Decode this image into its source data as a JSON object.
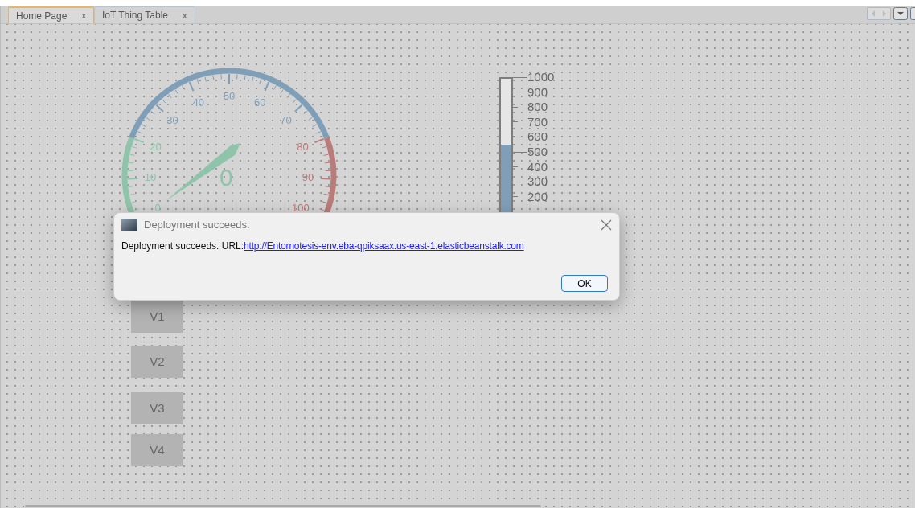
{
  "tabs": [
    {
      "label": "Home Page",
      "close": "x",
      "selected": true
    },
    {
      "label": "IoT Thing Table",
      "close": "x",
      "selected": false
    }
  ],
  "gauge": {
    "labels": [
      "0",
      "10",
      "20",
      "30",
      "40",
      "50",
      "60",
      "70",
      "80",
      "90",
      "100"
    ],
    "value": "0"
  },
  "thermometer": {
    "level": 0.5,
    "labels": [
      "1000",
      "900",
      "800",
      "700",
      "600",
      "500",
      "400",
      "300",
      "200"
    ]
  },
  "buttons": [
    "V1",
    "V2",
    "V3",
    "V4"
  ],
  "dialog": {
    "title": "Deployment succeeds.",
    "message": "Deployment succeeds. URL:",
    "link": "http://Entornotesis-env.eba-qpiksaax.us-east-1.elasticbeanstalk.com",
    "ok": "OK"
  }
}
